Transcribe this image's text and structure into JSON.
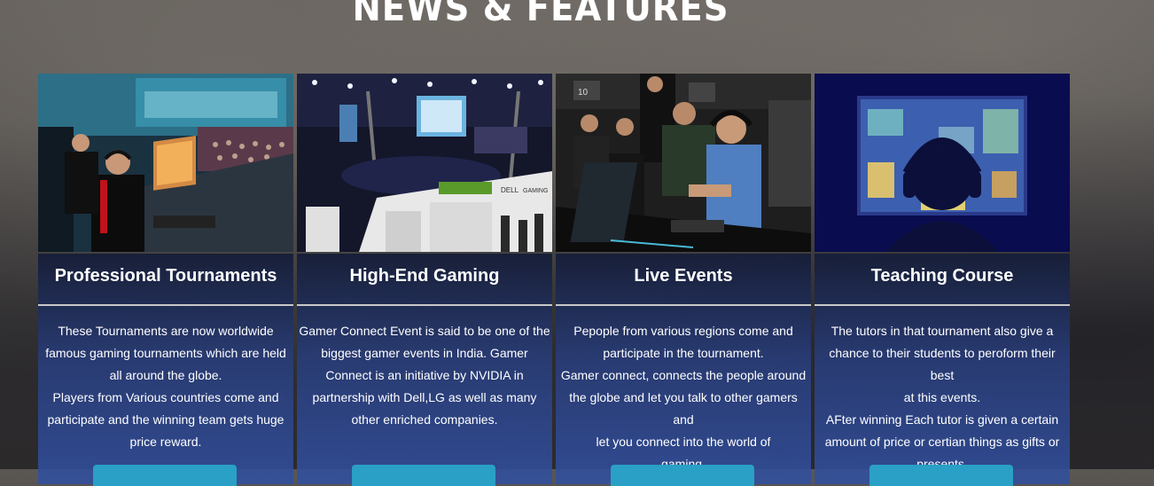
{
  "section": {
    "title": "NEWS & FEATURES"
  },
  "cards": [
    {
      "title": "Professional Tournaments",
      "lines": [
        "These Tournaments are now worldwide",
        "famous gaming tournaments which are held",
        "all around the globe.",
        "Players from Various countries come and",
        "participate and the winning team gets huge",
        "price reward."
      ]
    },
    {
      "title": "High-End Gaming",
      "lines": [
        "Gamer Connect Event is said to be one of the",
        "biggest gamer events in India. Gamer",
        "Connect is an initiative by NVIDIA in",
        "partnership with Dell,LG as well as many",
        "other enriched companies."
      ]
    },
    {
      "title": "Live Events",
      "lines": [
        "Pepople from various regions come and",
        "participate in the tournament.",
        "Gamer connect, connects the people around",
        "the globe and let you talk to other gamers and",
        "let you connect into the world of",
        "gaming."
      ]
    },
    {
      "title": "Teaching Course",
      "lines": [
        "The tutors in that tournament also give a",
        "chance to their students to peroform their best",
        "at this events.",
        "AFter winning Each tutor is given a certain",
        "amount of price or certian things as gifts or",
        "presents."
      ]
    }
  ],
  "image_labels": {
    "card2": [
      "DELL",
      "GAMING"
    ],
    "card3": [
      "10"
    ]
  }
}
